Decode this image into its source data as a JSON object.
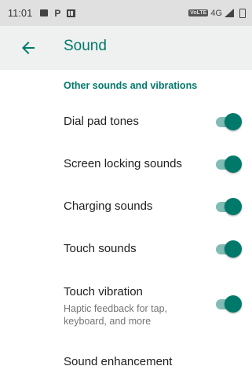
{
  "status_bar": {
    "time": "11:01",
    "network_label": "VoLTE",
    "network_type": "4G",
    "icons": [
      "image-notification-icon",
      "pinterest-icon",
      "frame-icon",
      "volte-icon",
      "signal-icon",
      "battery-icon"
    ]
  },
  "app_bar": {
    "title": "Sound",
    "back_icon": "arrow-back-icon"
  },
  "section": {
    "header": "Other sounds and vibrations"
  },
  "settings": [
    {
      "label": "Dial pad tones",
      "enabled": true
    },
    {
      "label": "Screen locking sounds",
      "enabled": true
    },
    {
      "label": "Charging sounds",
      "enabled": true
    },
    {
      "label": "Touch sounds",
      "enabled": true
    },
    {
      "label": "Touch vibration",
      "summary": "Haptic feedback for tap, keyboard, and more",
      "enabled": true
    },
    {
      "label": "Sound enhancement"
    }
  ],
  "colors": {
    "accent": "#00796b",
    "toggle_track": "#7fbcb5",
    "status_bar": "#e0e0e0",
    "app_bar": "#eef1f0"
  }
}
